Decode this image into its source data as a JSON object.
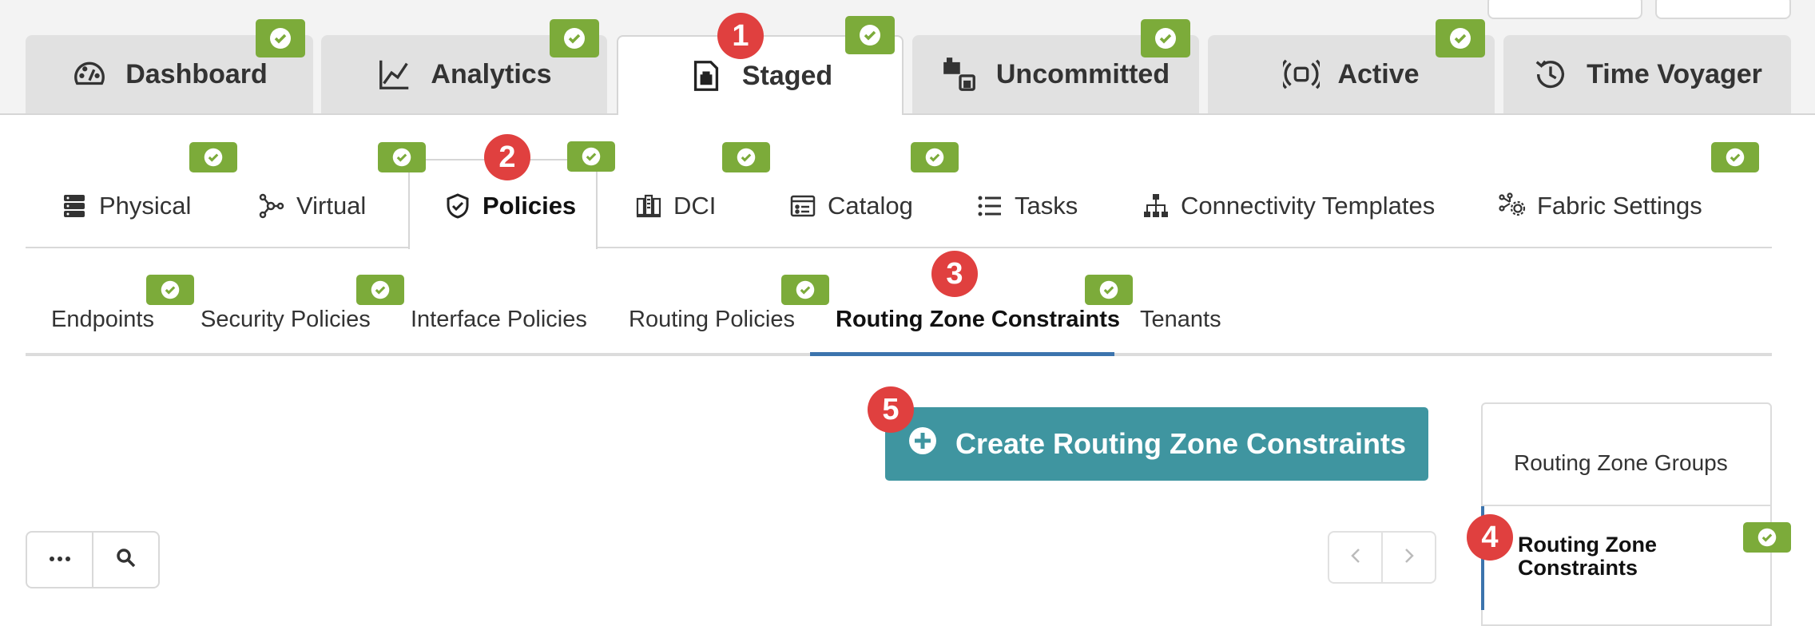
{
  "main_tabs": [
    {
      "label": "Dashboard",
      "icon": "dashboard-gauge-icon"
    },
    {
      "label": "Analytics",
      "icon": "analytics-chart-icon"
    },
    {
      "label": "Staged",
      "icon": "staged-clipboard-icon",
      "active": true
    },
    {
      "label": "Uncommitted",
      "icon": "uncommitted-boxes-icon"
    },
    {
      "label": "Active",
      "icon": "active-broadcast-icon"
    },
    {
      "label": "Time Voyager",
      "icon": "history-clock-icon"
    }
  ],
  "sub_tabs": [
    {
      "label": "Physical",
      "icon": "server-stack-icon"
    },
    {
      "label": "Virtual",
      "icon": "network-nodes-icon"
    },
    {
      "label": "Policies",
      "icon": "shield-check-icon",
      "active": true
    },
    {
      "label": "DCI",
      "icon": "dci-buildings-icon"
    },
    {
      "label": "Catalog",
      "icon": "catalog-window-icon"
    },
    {
      "label": "Tasks",
      "icon": "task-list-icon"
    },
    {
      "label": "Connectivity Templates",
      "icon": "hierarchy-icon"
    },
    {
      "label": "Fabric Settings",
      "icon": "fabric-gear-icon"
    }
  ],
  "third_tabs": [
    {
      "label": "Endpoints"
    },
    {
      "label": "Security Policies"
    },
    {
      "label": "Interface Policies"
    },
    {
      "label": "Routing Policies"
    },
    {
      "label": "Routing Zone Constraints",
      "active": true
    },
    {
      "label": "Tenants"
    }
  ],
  "create_button": {
    "label": "Create Routing Zone Constraints",
    "icon": "plus-circle-icon"
  },
  "side_panel": {
    "items": [
      {
        "label": "Routing Zone Groups"
      },
      {
        "label": "Routing Zone Constraints",
        "active": true
      }
    ]
  },
  "badges": {
    "b1": "1",
    "b2": "2",
    "b3": "3",
    "b4": "4",
    "b5": "5"
  },
  "colors": {
    "check_green": "#7cab3a",
    "badge_red": "#e0403f",
    "primary_teal": "#3f95a0",
    "active_blue": "#3c74ad"
  }
}
